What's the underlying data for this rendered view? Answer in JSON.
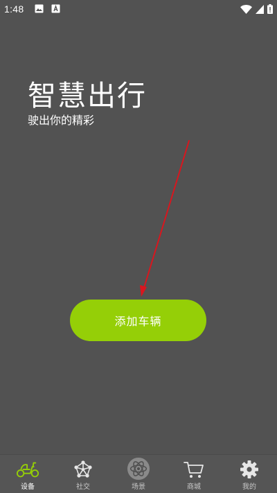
{
  "status_bar": {
    "time": "1:48",
    "icons": [
      "image-icon",
      "a-icon",
      "wifi-icon",
      "signal-icon",
      "battery-icon"
    ]
  },
  "hero": {
    "title": "智慧出行",
    "subtitle": "驶出你的精彩"
  },
  "main": {
    "add_vehicle_label": "添加车辆",
    "accent_color": "#95cf07",
    "annotation_color": "#d9161e"
  },
  "nav": {
    "items": [
      {
        "label": "设备",
        "icon": "scooter-icon",
        "active": true
      },
      {
        "label": "社交",
        "icon": "network-icon",
        "active": false
      },
      {
        "label": "场景",
        "icon": "atom-icon",
        "active": false
      },
      {
        "label": "商城",
        "icon": "cart-icon",
        "active": false
      },
      {
        "label": "我的",
        "icon": "gear-icon",
        "active": false
      }
    ]
  },
  "colors": {
    "background": "#525252",
    "nav_background": "#555555",
    "text": "#ffffff"
  }
}
